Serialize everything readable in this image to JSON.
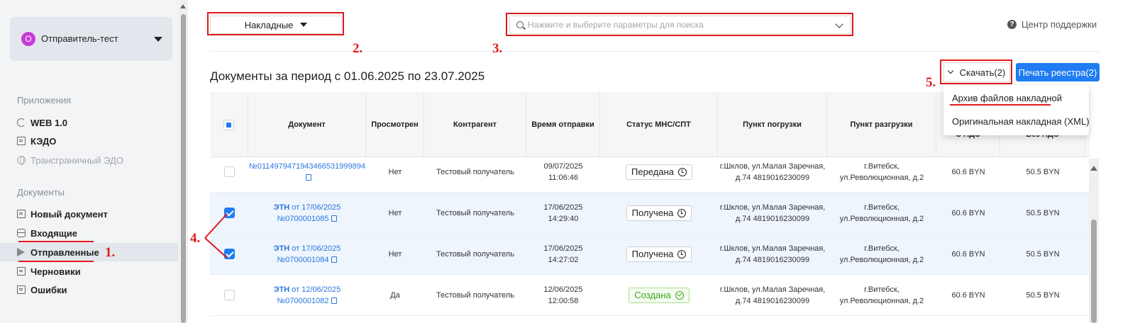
{
  "sidebar": {
    "org": {
      "initial": "О",
      "name": "Отправитель-тест"
    },
    "apps_heading": "Приложения",
    "apps": [
      {
        "label": "WEB 1.0"
      },
      {
        "label": "КЭДО"
      },
      {
        "label": "Трансграничный ЭДО"
      }
    ],
    "docs_heading": "Документы",
    "docs": [
      {
        "label": "Новый документ"
      },
      {
        "label": "Входящие"
      },
      {
        "label": "Отправленные"
      },
      {
        "label": "Черновики"
      },
      {
        "label": "Ошибки"
      }
    ],
    "active_item": "Отправленные"
  },
  "toolbar": {
    "doc_type": "Накладные",
    "search_placeholder": "Нажмите и выберите параметры для поиска",
    "help": "Центр поддержки"
  },
  "content": {
    "period_title": "Документы за период с 01.06.2025 по 23.07.2025",
    "download_label": "Скачать(2)",
    "print_label": "Печать реестра(2)"
  },
  "download_menu": [
    {
      "label": "Архив файлов накладной"
    },
    {
      "label": "Оригинальная накладная (XML)"
    }
  ],
  "table": {
    "headers": {
      "document": "Документ",
      "viewed": "Просмотрен",
      "counterparty": "Контрагент",
      "send_time": "Время отправки",
      "status": "Статус МНС/СПТ",
      "loading": "Пункт погрузки",
      "unloading": "Пункт разгрузки",
      "with_vat": "С НДС",
      "without_vat": "Без НДС"
    },
    "rows": [
      {
        "checked": false,
        "doc_type": "",
        "doc_date": "",
        "doc_number": "№011497947194346653199989​4",
        "viewed": "Нет",
        "counterparty": "Тестовый получатель",
        "date": "09/07/2025",
        "time": "11:06:46",
        "status": "Передана",
        "loading_1": "г.Шклов, ул.Малая Заречная,",
        "loading_2": "д.74 4819016230099",
        "unloading_1": "г.Витебск,",
        "unloading_2": "ул.Революционная, д.2",
        "with_vat": "60.6 BYN",
        "without_vat": "50.5 BYN"
      },
      {
        "checked": true,
        "doc_type": "ЭТН",
        "doc_date": " от 17/06/2025",
        "doc_number": "№0700001085",
        "viewed": "Нет",
        "counterparty": "Тестовый получатель",
        "date": "17/06/2025",
        "time": "14:29:40",
        "status": "Получена",
        "loading_1": "г.Шклов, ул.Малая Заречная,",
        "loading_2": "д.74 4819016230099",
        "unloading_1": "г.Витебск,",
        "unloading_2": "ул.Революционная, д.2",
        "with_vat": "60.6 BYN",
        "without_vat": "50.5 BYN"
      },
      {
        "checked": true,
        "doc_type": "ЭТН",
        "doc_date": " от 17/06/2025",
        "doc_number": "№0700001084",
        "viewed": "Нет",
        "counterparty": "Тестовый получатель",
        "date": "17/06/2025",
        "time": "14:27:02",
        "status": "Получена",
        "loading_1": "г.Шклов, ул.Малая Заречная,",
        "loading_2": "д.74 4819016230099",
        "unloading_1": "г.Витебск,",
        "unloading_2": "ул.Революционная, д.2",
        "with_vat": "60.6 BYN",
        "without_vat": "50.5 BYN"
      },
      {
        "checked": false,
        "doc_type": "ЭТН",
        "doc_date": " от 12/06/2025",
        "doc_number": "№0700001082",
        "viewed": "Да",
        "counterparty": "Тестовый получатель",
        "date": "12/06/2025",
        "time": "12:00:58",
        "status": "Создана",
        "loading_1": "г.Шклов, ул.Малая Заречная,",
        "loading_2": "д.74 4819016230099",
        "unloading_1": "г.Витебск,",
        "unloading_2": "ул.Революционная, д.2",
        "with_vat": "60.6 BYN",
        "without_vat": "50.5 BYN"
      }
    ]
  },
  "annotations": {
    "m1": "1.",
    "m2": "2.",
    "m3": "3.",
    "m4": "4.",
    "m5": "5.",
    "color": "#e01b1b"
  },
  "colors": {
    "accent": "#1f7cf2",
    "link": "#2a77e0",
    "status_created": "#3fa91e"
  }
}
